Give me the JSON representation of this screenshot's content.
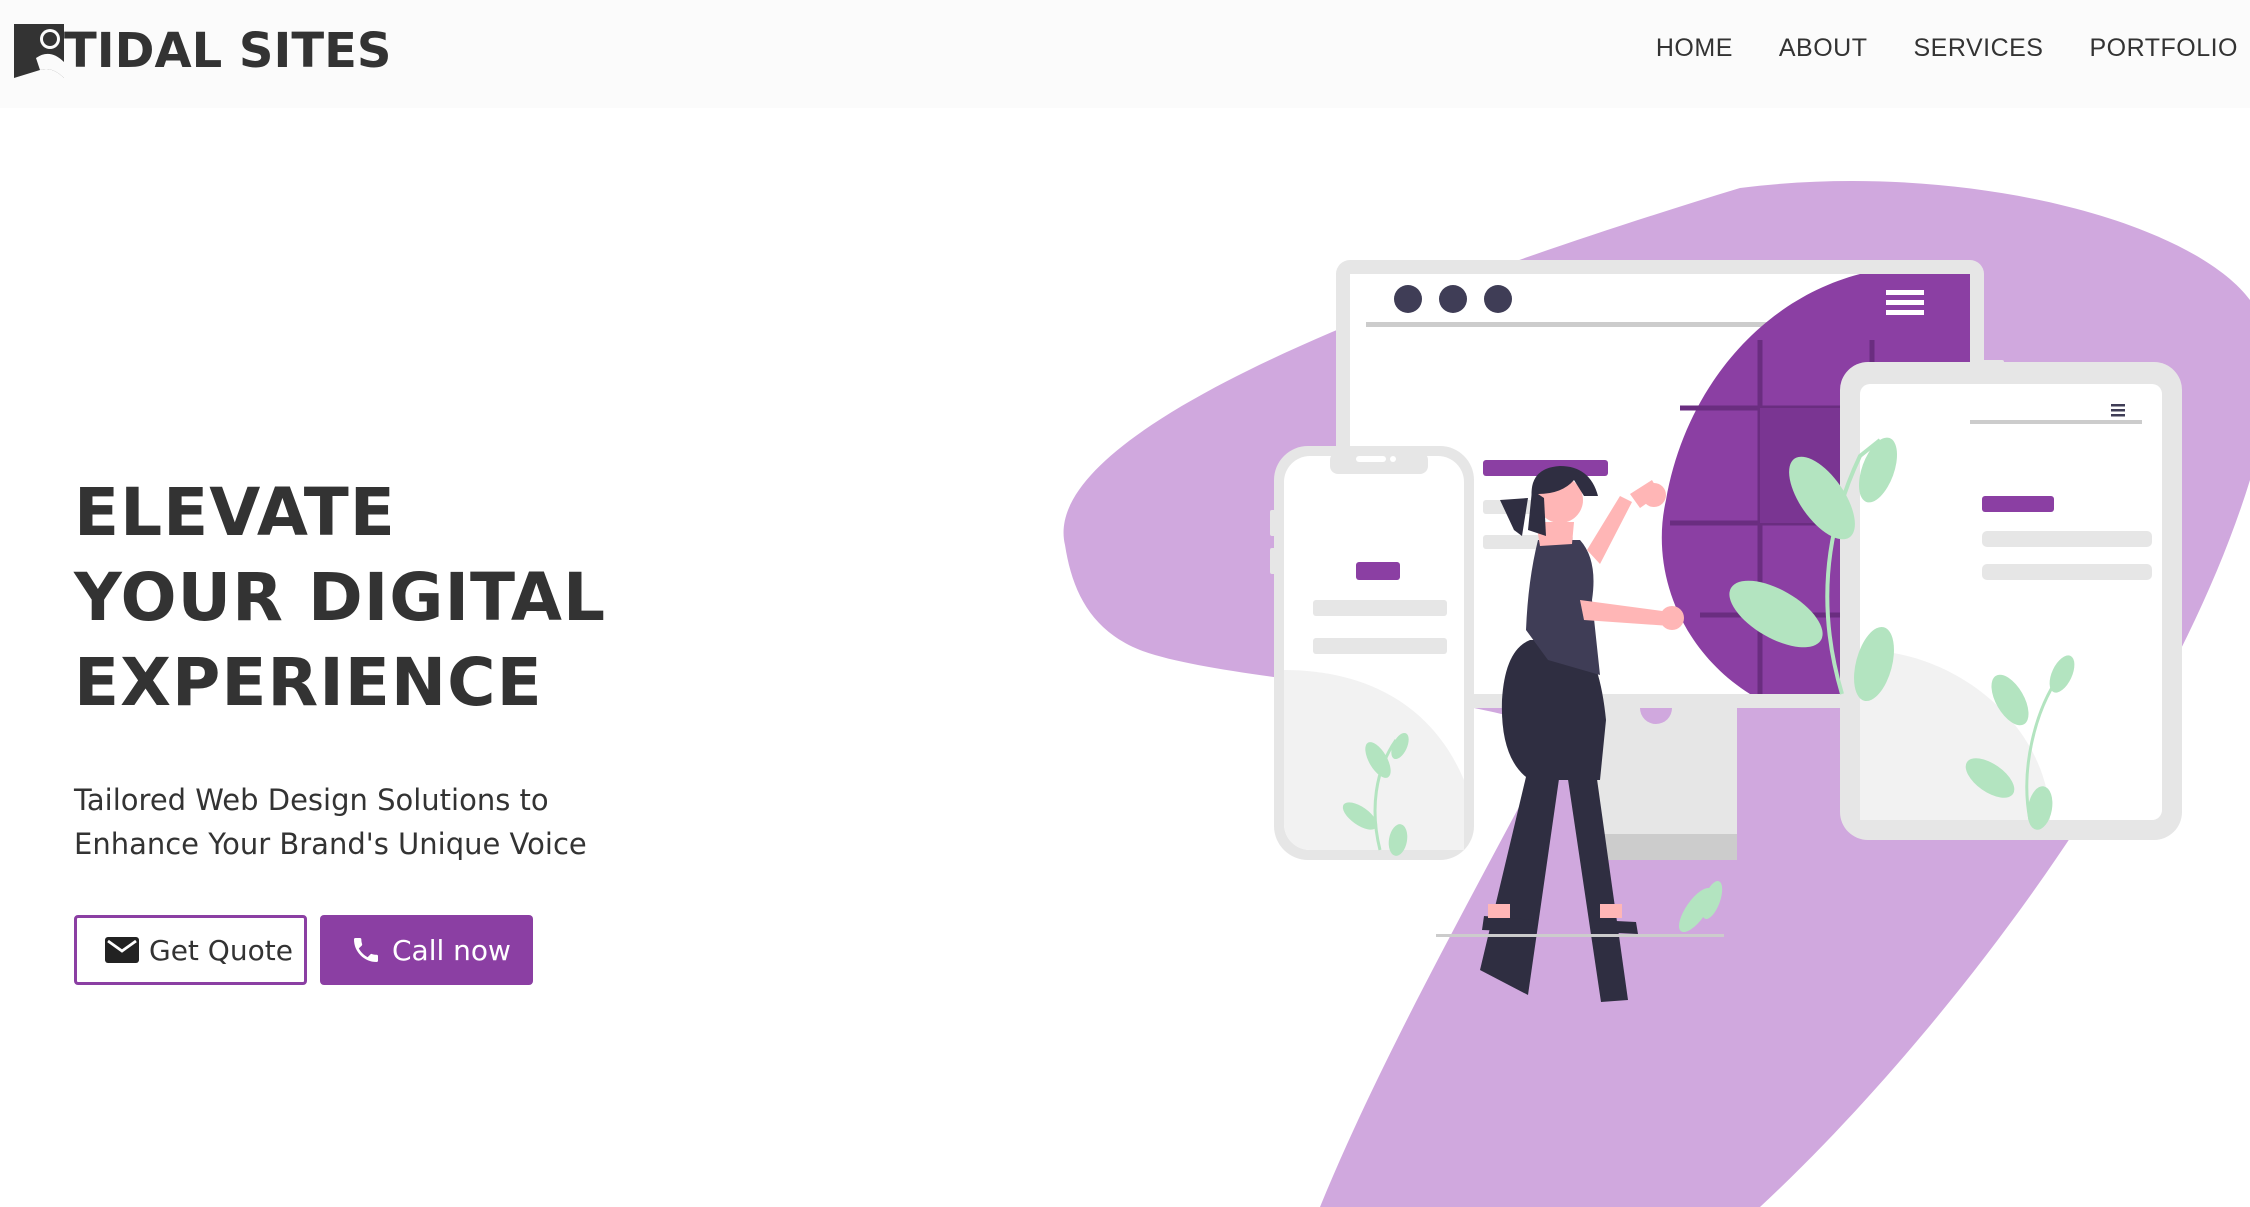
{
  "brand": {
    "name": "TIDAL SITES",
    "logo_icon": "person-wave-logo-icon"
  },
  "nav": {
    "items": [
      {
        "label": "HOME"
      },
      {
        "label": "ABOUT"
      },
      {
        "label": "SERVICES"
      },
      {
        "label": "PORTFOLIO"
      }
    ]
  },
  "hero": {
    "headline": [
      "ELEVATE",
      "YOUR DIGITAL",
      "EXPERIENCE"
    ],
    "subtitle": [
      "Tailored Web Design Solutions to",
      "Enhance Your Brand's Unique Voice"
    ],
    "buttons": {
      "quote": {
        "label": "Get Quote",
        "icon": "envelope-icon"
      },
      "call": {
        "label": "Call now",
        "icon": "phone-icon"
      }
    }
  },
  "colors": {
    "accent": "#8b3fa3",
    "blob": "#d0a8de",
    "text": "#333333",
    "leaf": "#b3e4c0"
  }
}
